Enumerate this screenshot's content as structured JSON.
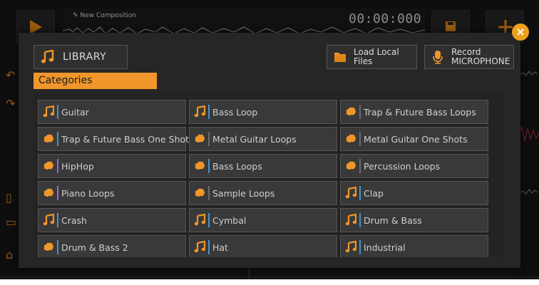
{
  "app": {
    "composition_name": "New Composition",
    "timer": "00:00:000"
  },
  "modal": {
    "library_label": "LIBRARY",
    "load_local_label": "Load Local\nFiles",
    "record_label": "Record\nMICROPHONE",
    "categories_tab": "Categories",
    "accent_color": "#f0962a",
    "categories": [
      {
        "label": "Guitar",
        "icon": "music-note-icon",
        "sep_color": "#4a90c8"
      },
      {
        "label": "Bass Loop",
        "icon": "music-note-icon",
        "sep_color": "#4a90c8"
      },
      {
        "label": "Trap & Future Bass Loops",
        "icon": "brain-icon",
        "sep_color": "#6a6a6a"
      },
      {
        "label": "Trap & Future Bass One Shot",
        "icon": "brain-icon",
        "sep_color": "#4a90c8"
      },
      {
        "label": "Metal Guitar Loops",
        "icon": "brain-icon",
        "sep_color": "#6a6a6a"
      },
      {
        "label": "Metal Guitar One Shots",
        "icon": "brain-icon",
        "sep_color": "#6a6a6a"
      },
      {
        "label": "HipHop",
        "icon": "brain-icon",
        "sep_color": "#9a6ac8"
      },
      {
        "label": "Bass Loops",
        "icon": "brain-icon",
        "sep_color": "#4a90c8"
      },
      {
        "label": "Percussion Loops",
        "icon": "brain-icon",
        "sep_color": "#6a6a6a"
      },
      {
        "label": "Piano Loops",
        "icon": "brain-icon",
        "sep_color": "#9a6ac8"
      },
      {
        "label": "Sample Loops",
        "icon": "brain-icon",
        "sep_color": "#6a6a6a"
      },
      {
        "label": "Clap",
        "icon": "music-note-icon",
        "sep_color": "#4a90c8"
      },
      {
        "label": "Crash",
        "icon": "music-note-icon",
        "sep_color": "#4a90c8"
      },
      {
        "label": "Cymbal",
        "icon": "music-note-icon",
        "sep_color": "#4a90c8"
      },
      {
        "label": "Drum & Bass",
        "icon": "music-note-icon",
        "sep_color": "#4a90c8"
      },
      {
        "label": "Drum & Bass 2",
        "icon": "brain-icon",
        "sep_color": "#4a90c8"
      },
      {
        "label": "Hat",
        "icon": "music-note-icon",
        "sep_color": "#4a90c8"
      },
      {
        "label": "Industrial",
        "icon": "music-note-icon",
        "sep_color": "#4a90c8"
      }
    ]
  }
}
